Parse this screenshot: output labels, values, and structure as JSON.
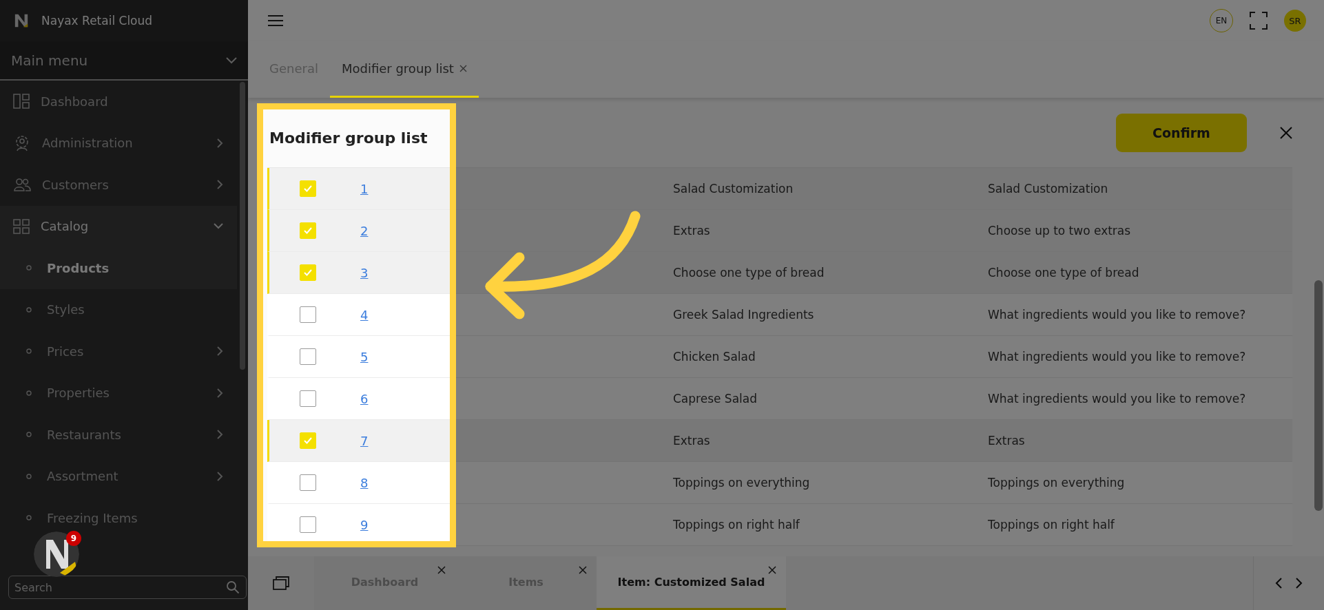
{
  "app": {
    "title": "Nayax Retail Cloud"
  },
  "sidebar": {
    "menu_title": "Main menu",
    "search": {
      "placeholder": "Search"
    },
    "items": [
      {
        "label": "Dashboard",
        "kind": "dashboard",
        "has_submenu": false,
        "expanded": false
      },
      {
        "label": "Administration",
        "kind": "gear-person",
        "has_submenu": true,
        "expanded": false
      },
      {
        "label": "Customers",
        "kind": "people",
        "has_submenu": true,
        "expanded": false
      },
      {
        "label": "Catalog",
        "kind": "grid",
        "has_submenu": true,
        "expanded": true,
        "children": [
          {
            "label": "Products",
            "has_submenu": false,
            "selected": true
          },
          {
            "label": "Styles",
            "has_submenu": false,
            "selected": false
          },
          {
            "label": "Prices",
            "has_submenu": true,
            "selected": false
          },
          {
            "label": "Properties",
            "has_submenu": true,
            "selected": false
          },
          {
            "label": "Restaurants",
            "has_submenu": true,
            "selected": false
          },
          {
            "label": "Assortment",
            "has_submenu": true,
            "selected": false
          },
          {
            "label": "Freezing Items",
            "has_submenu": false,
            "selected": false
          }
        ]
      }
    ]
  },
  "notification_badge": "9",
  "header": {
    "language": "EN",
    "user_initials": "SR"
  },
  "tabs": [
    {
      "label": "General",
      "selected": false,
      "closable": false
    },
    {
      "label": "Modifier group list",
      "selected": true,
      "closable": true
    }
  ],
  "panel": {
    "title": "Modifier group list",
    "confirm_button": "Confirm"
  },
  "rows": [
    {
      "checked": true,
      "id": "1",
      "name": "Salad Customization",
      "description": "Salad Customization"
    },
    {
      "checked": true,
      "id": "2",
      "name": "Extras",
      "description": "Choose up to two extras"
    },
    {
      "checked": true,
      "id": "3",
      "name": "Choose one type of bread",
      "description": "Choose one type of bread"
    },
    {
      "checked": false,
      "id": "4",
      "name": "Greek Salad Ingredients",
      "description": "What ingredients would you like to remove?"
    },
    {
      "checked": false,
      "id": "5",
      "name": "Chicken Salad",
      "description": "What ingredients would you like to remove?"
    },
    {
      "checked": false,
      "id": "6",
      "name": "Caprese Salad",
      "description": "What ingredients would you like to remove?"
    },
    {
      "checked": true,
      "id": "7",
      "name": "Extras",
      "description": "Extras"
    },
    {
      "checked": false,
      "id": "8",
      "name": "Toppings on everything",
      "description": "Toppings on everything"
    },
    {
      "checked": false,
      "id": "9",
      "name": "Toppings on right half",
      "description": "Toppings on right half"
    }
  ],
  "bottom_tabs": [
    {
      "label": "Dashboard",
      "selected": false
    },
    {
      "label": "Items",
      "selected": false
    },
    {
      "label": "Item: Customized Salad",
      "selected": true
    }
  ]
}
